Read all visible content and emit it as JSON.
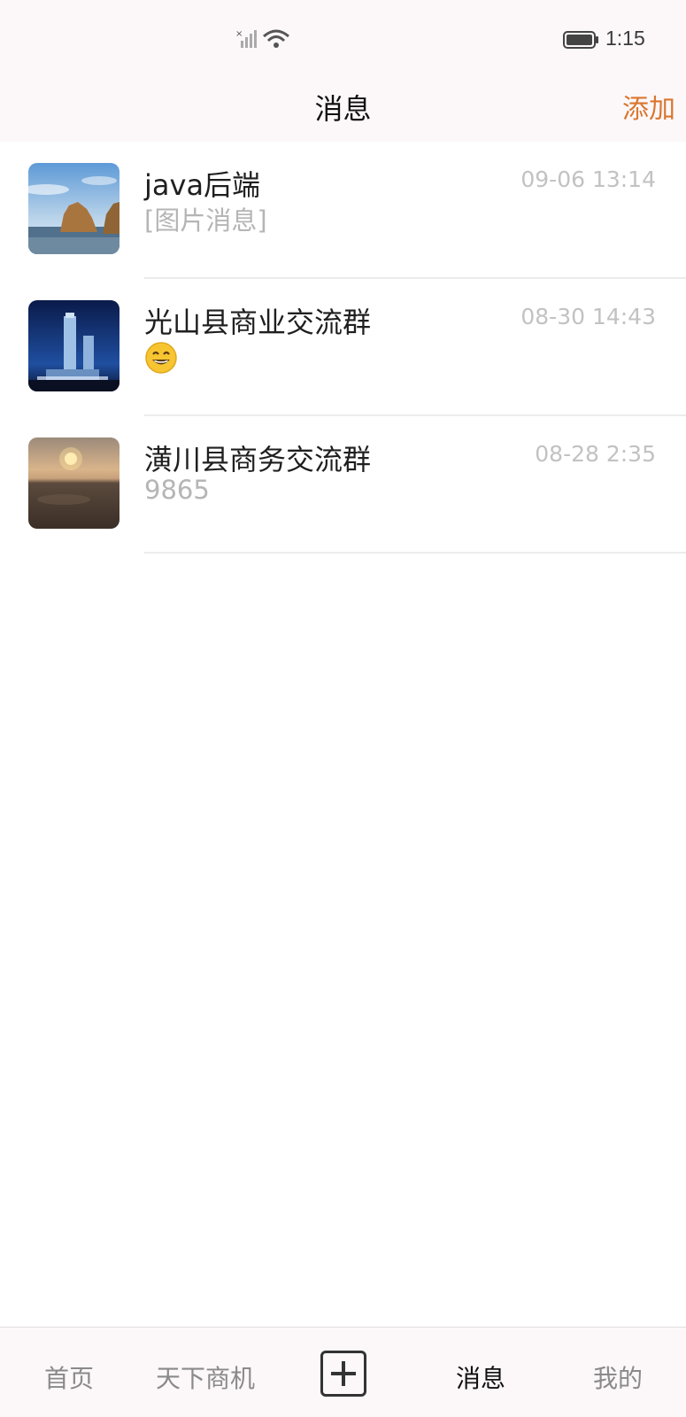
{
  "status_bar": {
    "time": "1:15",
    "icons": [
      "signal-icon",
      "wifi-icon",
      "battery-icon"
    ]
  },
  "header": {
    "title": "消息",
    "add_label": "添加"
  },
  "conversations": [
    {
      "name": "java后端",
      "preview": "[图片消息]",
      "time": "09-06 13:14",
      "avatar": "coastal-rock-avatar"
    },
    {
      "name": "光山县商业交流群",
      "preview": "",
      "preview_icon": "grinning-face-emoji",
      "time": "08-30 14:43",
      "avatar": "skyscraper-avatar"
    },
    {
      "name": "潢川县商务交流群",
      "preview": "9865",
      "time": "08-28 2:35",
      "avatar": "sunset-avatar"
    }
  ],
  "tabbar": {
    "home": "首页",
    "business": "天下商机",
    "plus_icon": "plus-square-icon",
    "messages": "消息",
    "me": "我的",
    "active_tab": "messages"
  },
  "colors": {
    "accent": "#d9772f",
    "bar_background": "#fcf7f9",
    "muted_text": "#b5b5b5"
  }
}
